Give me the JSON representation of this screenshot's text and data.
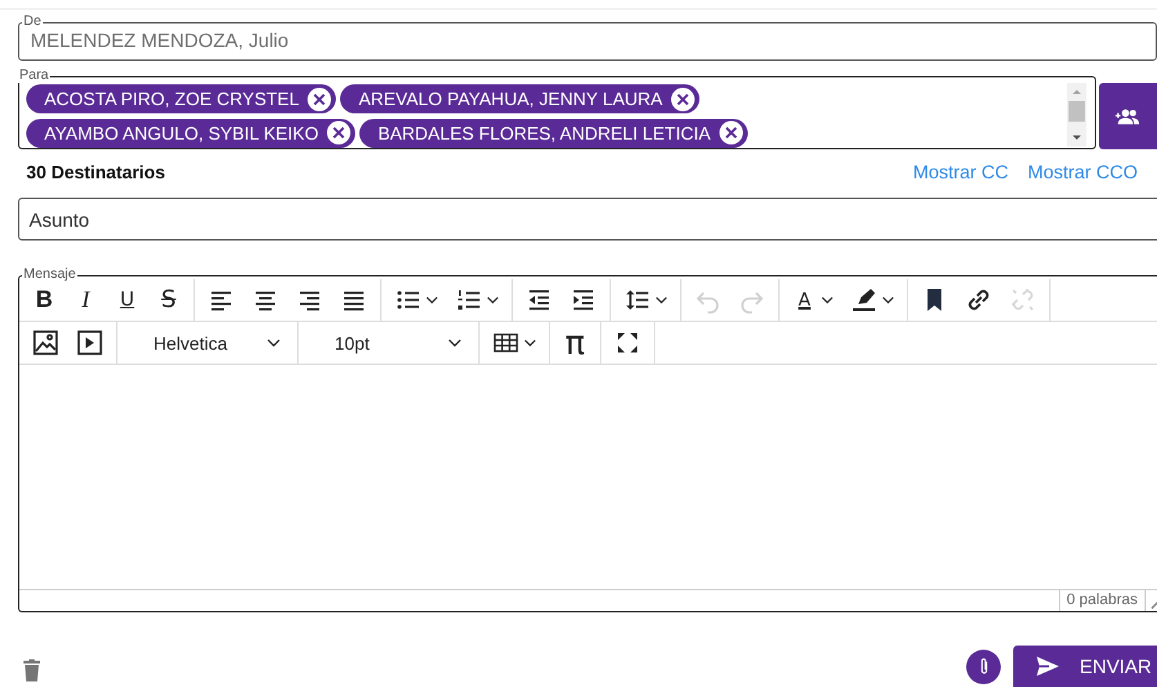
{
  "from": {
    "label": "De",
    "value": "MELENDEZ MENDOZA, Julio"
  },
  "to": {
    "label": "Para",
    "recipients": [
      {
        "name": "ACOSTA PIRO, ZOE CRYSTEL"
      },
      {
        "name": "AREVALO PAYAHUA, JENNY LAURA"
      },
      {
        "name": "AYAMBO ANGULO, SYBIL KEIKO"
      },
      {
        "name": "BARDALES FLORES, ANDRELI LETICIA"
      }
    ]
  },
  "recipient_count": "30 Destinatarios",
  "links": [
    "Mostrar CC",
    "Mostrar CCO"
  ],
  "subject": {
    "placeholder": "Asunto"
  },
  "editor": {
    "label": "Mensaje",
    "toolbar": [
      [
        [
          {
            "kind": "bold",
            "glyph": "B"
          },
          {
            "kind": "italic",
            "glyph": "I"
          },
          {
            "kind": "underline",
            "glyph": "U"
          },
          {
            "kind": "strike",
            "glyph": "S"
          }
        ],
        [
          {
            "kind": "align-left"
          },
          {
            "kind": "align-center"
          },
          {
            "kind": "align-right"
          },
          {
            "kind": "justify"
          }
        ],
        [
          {
            "kind": "bullet-list",
            "dropdown": true
          },
          {
            "kind": "numbered-list",
            "dropdown": true
          }
        ],
        [
          {
            "kind": "outdent"
          },
          {
            "kind": "indent"
          }
        ],
        [
          {
            "kind": "line-height",
            "dropdown": true
          }
        ],
        [
          {
            "kind": "undo",
            "disabled": true
          },
          {
            "kind": "redo",
            "disabled": true
          }
        ],
        [
          {
            "kind": "text-color",
            "glyph": "A",
            "dropdown": true
          },
          {
            "kind": "highlight",
            "dropdown": true
          }
        ],
        [
          {
            "kind": "bookmark"
          },
          {
            "kind": "link"
          },
          {
            "kind": "unlink",
            "disabled": true
          }
        ]
      ],
      [
        [
          {
            "kind": "image"
          },
          {
            "kind": "media"
          }
        ],
        [
          {
            "kind": "select",
            "value": "Helvetica"
          }
        ],
        [
          {
            "kind": "select",
            "value": "10pt"
          }
        ],
        [
          {
            "kind": "table",
            "dropdown": true
          }
        ],
        [
          {
            "kind": "symbol",
            "glyph": "π"
          }
        ],
        [
          {
            "kind": "fullscreen"
          }
        ]
      ]
    ],
    "word_count": "0 palabras"
  },
  "send_button": "ENVIAR"
}
